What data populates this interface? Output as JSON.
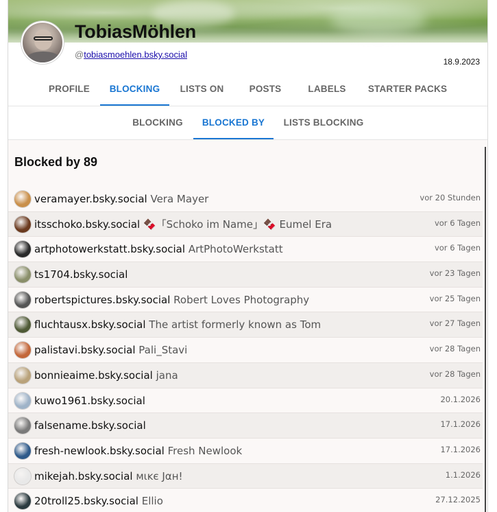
{
  "profile": {
    "display_name": "TobiasMöhlen",
    "handle_prefix": "@",
    "handle": "tobiasmoehlen.bsky.social",
    "joined_date": "18.9.2023"
  },
  "main_tabs": [
    {
      "label": "PROFILE",
      "active": false
    },
    {
      "label": "BLOCKING",
      "active": true
    },
    {
      "label": "LISTS ON",
      "active": false
    },
    {
      "label": "POSTS",
      "active": false
    },
    {
      "label": "LABELS",
      "active": false
    },
    {
      "label": "STARTER PACKS",
      "active": false
    }
  ],
  "sub_tabs": [
    {
      "label": "BLOCKING",
      "active": false
    },
    {
      "label": "BLOCKED BY",
      "active": true
    },
    {
      "label": "LISTS BLOCKING",
      "active": false
    }
  ],
  "section_title": "Blocked by 89",
  "rows": [
    {
      "handle": "veramayer.bsky.social",
      "name": "Vera Mayer",
      "time": "vor 20 Stunden",
      "avatar_color": "#c98f4a"
    },
    {
      "handle": "itsschoko.bsky.social",
      "name": "🍫「Schoko im Name」🍫 Eumel Era",
      "time": "vor 6 Tagen",
      "avatar_color": "#6b3a1f"
    },
    {
      "handle": "artphotowerkstatt.bsky.social",
      "name": "ArtPhotoWerkstatt",
      "time": "vor 6 Tagen",
      "avatar_color": "#2a2a2a"
    },
    {
      "handle": "ts1704.bsky.social",
      "name": "",
      "time": "vor 23 Tagen",
      "avatar_color": "#8a8f6a"
    },
    {
      "handle": "robertspictures.bsky.social",
      "name": "Robert Loves Photography",
      "time": "vor 25 Tagen",
      "avatar_color": "#555555"
    },
    {
      "handle": "fluchtausx.bsky.social",
      "name": "The artist formerly known as Tom",
      "time": "vor 27 Tagen",
      "avatar_color": "#4f5a36"
    },
    {
      "handle": "palistavi.bsky.social",
      "name": "Pali_Stavi",
      "time": "vor 28 Tagen",
      "avatar_color": "#c3673a"
    },
    {
      "handle": "bonnieaime.bsky.social",
      "name": "jana",
      "time": "vor 28 Tagen",
      "avatar_color": "#b9a27a"
    },
    {
      "handle": "kuwo1961.bsky.social",
      "name": "",
      "time": "20.1.2026",
      "avatar_color": "#9fb3c8"
    },
    {
      "handle": "falsename.bsky.social",
      "name": "",
      "time": "17.1.2026",
      "avatar_color": "#7a7a7a"
    },
    {
      "handle": "fresh-newlook.bsky.social",
      "name": "Fresh Newlook",
      "time": "17.1.2026",
      "avatar_color": "#2f5a8a"
    },
    {
      "handle": "mikejah.bsky.social",
      "name": "ᴍιᴋє Jαн!",
      "time": "1.1.2026",
      "avatar_color": "#e8e8e8"
    },
    {
      "handle": "20troll25.bsky.social",
      "name": "Ellio",
      "time": "27.12.2025",
      "avatar_color": "#2b3a3f"
    }
  ]
}
